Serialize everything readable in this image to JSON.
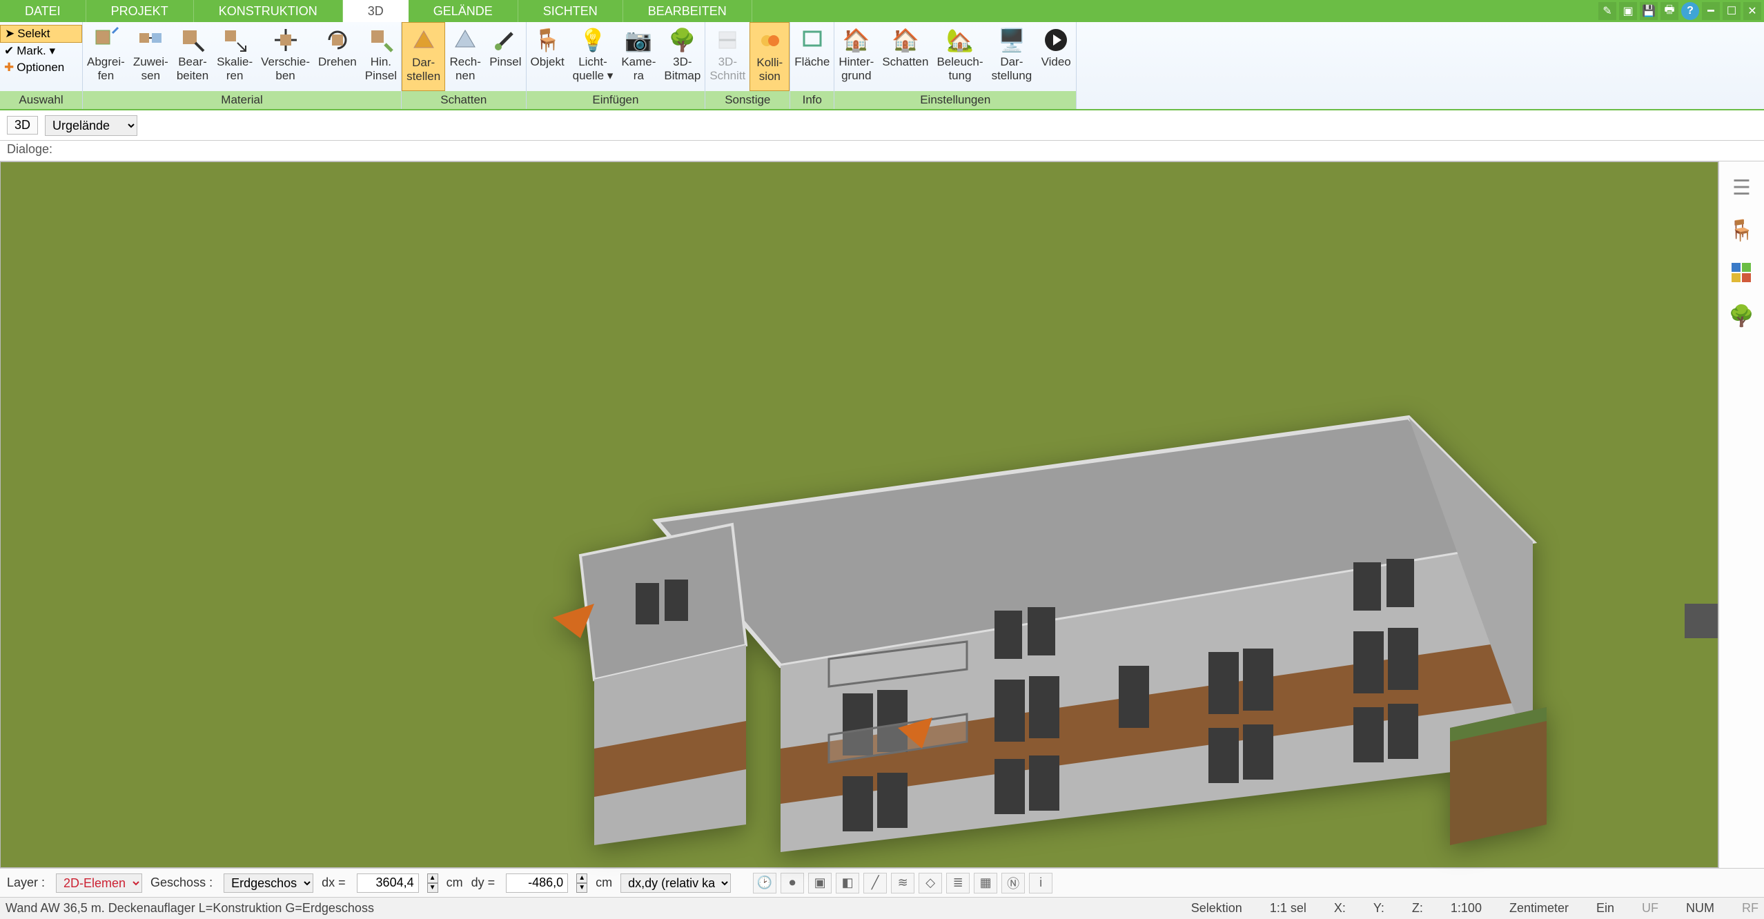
{
  "menu": {
    "tabs": [
      "DATEI",
      "PROJEKT",
      "KONSTRUKTION",
      "3D",
      "GELÄNDE",
      "SICHTEN",
      "BEARBEITEN"
    ],
    "active_index": 3
  },
  "ribbon": {
    "selection": {
      "selekt": "Selekt",
      "mark": "Mark. ▾",
      "optionen": "Optionen",
      "group_label": "Auswahl"
    },
    "groups": [
      {
        "label": "Material",
        "buttons": [
          {
            "name": "abgreifen",
            "l1": "Abgrei-",
            "l2": "fen"
          },
          {
            "name": "zuweisen",
            "l1": "Zuwei-",
            "l2": "sen"
          },
          {
            "name": "bearbeiten",
            "l1": "Bear-",
            "l2": "beiten"
          },
          {
            "name": "skalieren",
            "l1": "Skalie-",
            "l2": "ren"
          },
          {
            "name": "verschieben",
            "l1": "Verschie-",
            "l2": "ben"
          },
          {
            "name": "drehen",
            "l1": "Drehen",
            "l2": ""
          },
          {
            "name": "hinpinsel",
            "l1": "Hin.",
            "l2": "Pinsel"
          }
        ]
      },
      {
        "label": "Schatten",
        "buttons": [
          {
            "name": "darstellen",
            "l1": "Dar-",
            "l2": "stellen",
            "highlight": true
          },
          {
            "name": "rechnen",
            "l1": "Rech-",
            "l2": "nen"
          },
          {
            "name": "pinsel",
            "l1": "Pinsel",
            "l2": ""
          }
        ]
      },
      {
        "label": "Einfügen",
        "buttons": [
          {
            "name": "objekt",
            "l1": "Objekt",
            "l2": ""
          },
          {
            "name": "lichtquelle",
            "l1": "Licht-",
            "l2": "quelle ▾"
          },
          {
            "name": "kamera",
            "l1": "Kame-",
            "l2": "ra"
          },
          {
            "name": "3d-bitmap",
            "l1": "3D-",
            "l2": "Bitmap"
          }
        ]
      },
      {
        "label": "Sonstige",
        "buttons": [
          {
            "name": "3d-schnitt",
            "l1": "3D-",
            "l2": "Schnitt",
            "dim": true
          },
          {
            "name": "kollision",
            "l1": "Kolli-",
            "l2": "sion",
            "highlight": true
          }
        ]
      },
      {
        "label": "Info",
        "buttons": [
          {
            "name": "flaeche",
            "l1": "Fläche",
            "l2": ""
          }
        ]
      },
      {
        "label": "Einstellungen",
        "buttons": [
          {
            "name": "hintergrund",
            "l1": "Hinter-",
            "l2": "grund"
          },
          {
            "name": "schatten",
            "l1": "Schatten",
            "l2": ""
          },
          {
            "name": "beleuchtung",
            "l1": "Beleuch-",
            "l2": "tung"
          },
          {
            "name": "darstellung",
            "l1": "Dar-",
            "l2": "stellung"
          },
          {
            "name": "video",
            "l1": "Video",
            "l2": ""
          }
        ]
      }
    ]
  },
  "subbar": {
    "view_mode": "3D",
    "dropdown": "Urgelände"
  },
  "dialoge_label": "Dialoge:",
  "bottom": {
    "layer_label": "Layer :",
    "layer_value": "2D-Elemen",
    "geschoss_label": "Geschoss :",
    "geschoss_value": "Erdgeschos",
    "dx_label": "dx =",
    "dx_value": "3604,4",
    "dx_unit": "cm",
    "dy_label": "dy =",
    "dy_value": "-486,0",
    "dy_unit": "cm",
    "mode": "dx,dy (relativ ka"
  },
  "status": {
    "left": "Wand AW 36,5 m. Deckenauflager L=Konstruktion G=Erdgeschoss",
    "selektion": "Selektion",
    "sel_count": "1:1 sel",
    "x": "X:",
    "y": "Y:",
    "z": "Z:",
    "scale": "1:100",
    "unit": "Zentimeter",
    "ein": "Ein",
    "uf": "UF",
    "num": "NUM",
    "rf": "RF"
  }
}
